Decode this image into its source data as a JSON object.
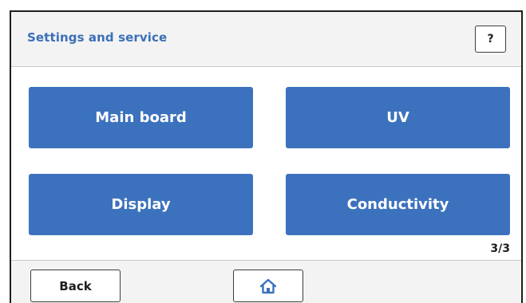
{
  "header": {
    "title": "Settings and service",
    "help_label": "?"
  },
  "menu": {
    "items": [
      {
        "label": "Main board"
      },
      {
        "label": "UV"
      },
      {
        "label": "Display"
      },
      {
        "label": "Conductivity"
      }
    ]
  },
  "pagination": {
    "text": "3/3",
    "current": 3,
    "total": 3
  },
  "footer": {
    "back_label": "Back",
    "home_icon": "home-icon"
  },
  "colors": {
    "accent": "#3c72bd",
    "title": "#3a6fb8",
    "panel_bg": "#f3f3f3"
  }
}
